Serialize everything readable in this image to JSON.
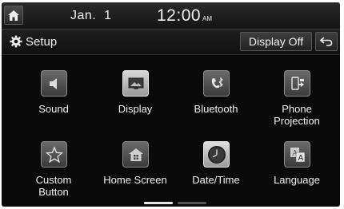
{
  "status": {
    "date": "Jan.  1",
    "time": "12:00",
    "ampm": "AM"
  },
  "header": {
    "title": "Setup",
    "display_off_label": "Display Off"
  },
  "menu": {
    "items": [
      {
        "label": "Sound",
        "icon": "speaker-icon"
      },
      {
        "label": "Display",
        "icon": "display-icon"
      },
      {
        "label": "Bluetooth",
        "icon": "bluetooth-phone-icon"
      },
      {
        "label": "Phone\nProjection",
        "icon": "phone-projection-icon"
      },
      {
        "label": "Custom\nButton",
        "icon": "star-icon"
      },
      {
        "label": "Home Screen",
        "icon": "home-screen-icon"
      },
      {
        "label": "Date/Time",
        "icon": "clock-icon"
      },
      {
        "label": "Language",
        "icon": "language-icon"
      }
    ]
  },
  "pager": {
    "pages": 2,
    "current": 1
  },
  "colors": {
    "background": "#0a0a0a",
    "text": "#f0f0f0",
    "button": "#2e2e2e",
    "pager_active": "#e6e6e6",
    "pager_inactive": "#555555"
  }
}
